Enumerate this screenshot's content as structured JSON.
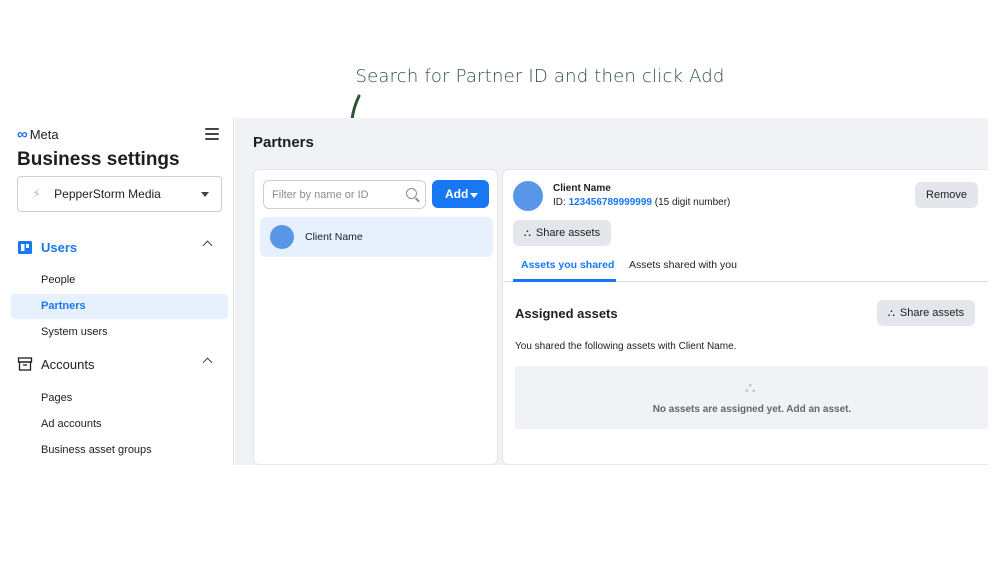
{
  "caption": "Search for Partner ID and then click Add",
  "colors": {
    "accent": "#1877f2",
    "caption": "#2f5238",
    "arrow": "#2f5238"
  },
  "sidebar": {
    "logo_text": "Meta",
    "title": "Business settings",
    "business_name": "PepperStorm Media",
    "users_section": "Users",
    "users_items": [
      "People",
      "Partners",
      "System users"
    ],
    "accounts_section": "Accounts",
    "accounts_items": [
      "Pages",
      "Ad accounts",
      "Business asset groups"
    ]
  },
  "main": {
    "title": "Partners",
    "filter_placeholder": "Filter by name or ID",
    "add_label": "Add",
    "client_name": "Client Name",
    "detail": {
      "name": "Client Name",
      "id_prefix": "ID:",
      "id_number": "123456789999999",
      "id_suffix": "(15 digit number)",
      "remove_label": "Remove",
      "share_label": "Share assets",
      "tab_1": "Assets you shared",
      "tab_2": "Assets shared with you",
      "assigned_title": "Assigned assets",
      "shared_text": "You shared the following assets with Client Name.",
      "share_label_2": "Share assets",
      "empty_text": "No assets are assigned yet. Add an asset."
    }
  }
}
